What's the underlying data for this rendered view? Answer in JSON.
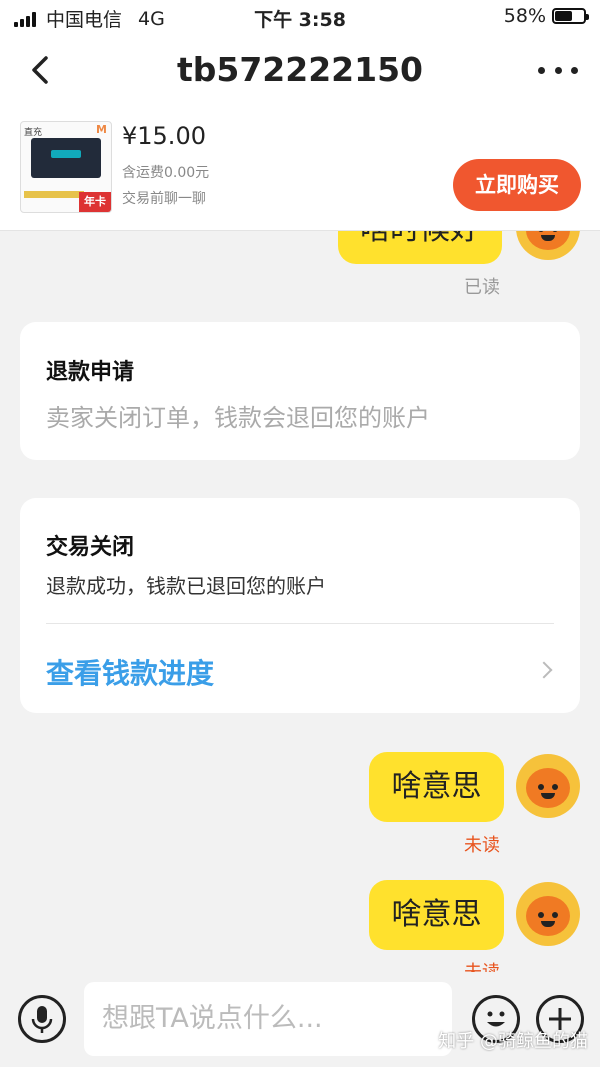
{
  "status_bar": {
    "carrier": "中国电信",
    "network": "4G",
    "time": "下午 3:58",
    "battery": "58%"
  },
  "header": {
    "title": "tb572222150"
  },
  "product": {
    "thumbnail_tag": "直充",
    "thumbnail_badge": "年卡",
    "price": "¥15.00",
    "shipping": "含运费0.00元",
    "chat_hint": "交易前聊一聊",
    "buy_label": "立即购买"
  },
  "messages": [
    {
      "type": "bubble",
      "text": "啥时候好",
      "status": "已读"
    },
    {
      "type": "card",
      "title": "退款申请",
      "subtitle": "卖家关闭订单，钱款会退回您的账户"
    },
    {
      "type": "card",
      "title": "交易关闭",
      "subtitle": "退款成功，钱款已退回您的账户",
      "link": "查看钱款进度"
    },
    {
      "type": "bubble",
      "text": "啥意思",
      "status": "未读"
    },
    {
      "type": "bubble",
      "text": "啥意思",
      "status": "未读"
    }
  ],
  "input_bar": {
    "placeholder": "想跟TA说点什么..."
  },
  "watermark": "知乎 @骑鲸鱼的猫",
  "colors": {
    "bubble": "#ffe12d",
    "buy_button": "#f0572f",
    "link": "#3a9ee8",
    "unread": "#e8541e",
    "read": "#999999"
  }
}
